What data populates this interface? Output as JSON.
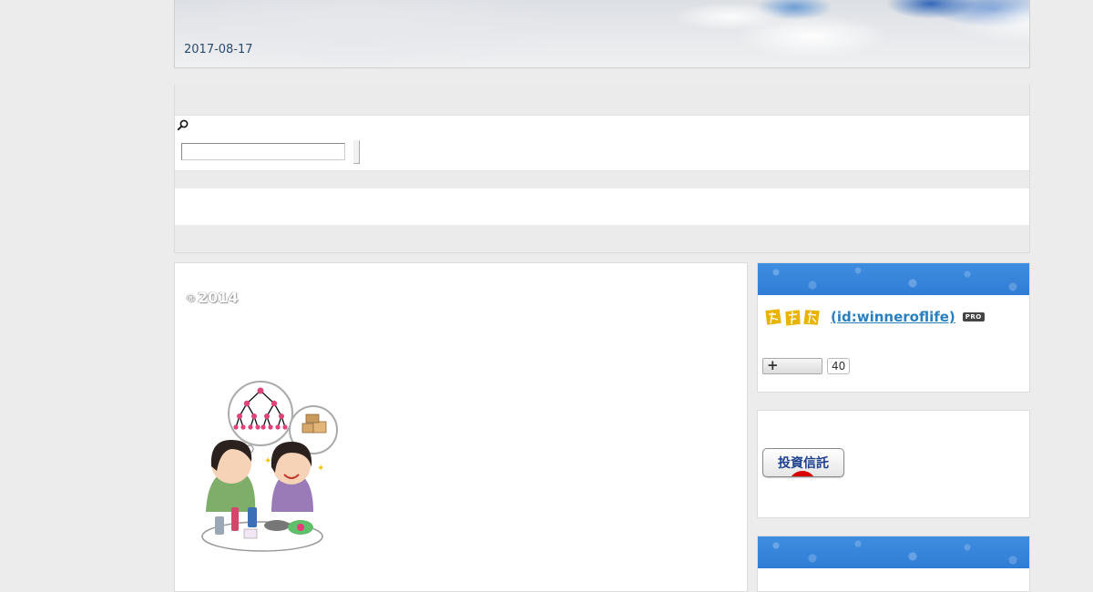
{
  "header": {
    "date": "2017-08-17"
  },
  "search": {
    "icon": "search-icon",
    "placeholder": ""
  },
  "main": {
    "copyright_symbol": "®",
    "copyright_year": "2014",
    "illustration": "two-women-network-marketing-illustration"
  },
  "sidebar": {
    "profile": {
      "display_name": " (id:winneroflife)",
      "logo": "yellow-brand-logo",
      "pro_badge": "PRO",
      "follow_symbol": "+",
      "follow_count": "40"
    },
    "fund_badge": {
      "label": "投資信託"
    }
  },
  "colors": {
    "sidebar_head": "#2f7cd6",
    "link": "#2a7fbf",
    "date": "#2b4a6b"
  }
}
